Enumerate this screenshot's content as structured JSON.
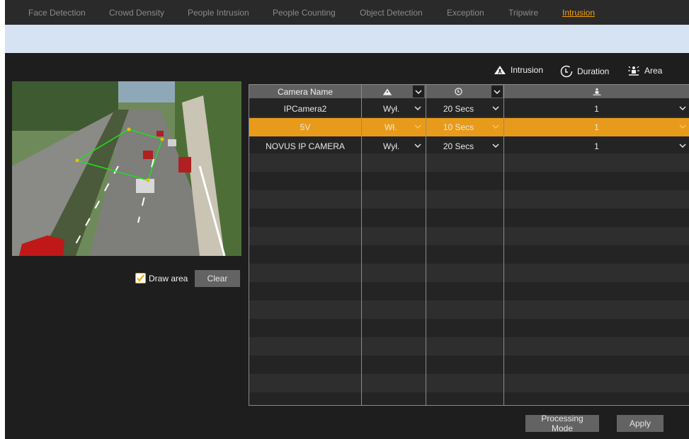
{
  "tabs": [
    {
      "label": "Face Detection",
      "active": false
    },
    {
      "label": "Crowd Density",
      "active": false
    },
    {
      "label": "People Intrusion",
      "active": false
    },
    {
      "label": "People Counting",
      "active": false
    },
    {
      "label": "Object Detection",
      "active": false
    },
    {
      "label": "Exception",
      "active": false
    },
    {
      "label": "Tripwire",
      "active": false
    },
    {
      "label": "Intrusion",
      "active": true
    }
  ],
  "legend": {
    "intrusion_label": "Intrusion",
    "duration_label": "Duration",
    "area_label": "Area"
  },
  "preview": {
    "draw_area_label": "Draw area",
    "draw_area_checked": true,
    "clear_label": "Clear"
  },
  "table": {
    "headers": {
      "camera_name": "Camera Name"
    },
    "rows": [
      {
        "camera": "IPCamera2",
        "intrusion": "Wył.",
        "duration": "20 Secs",
        "area": "1",
        "selected": false
      },
      {
        "camera": "5V",
        "intrusion": "Wł.",
        "duration": "10 Secs",
        "area": "1",
        "selected": true
      },
      {
        "camera": "NOVUS IP CAMERA",
        "intrusion": "Wył.",
        "duration": "20 Secs",
        "area": "1",
        "selected": false
      }
    ]
  },
  "footer": {
    "processing_mode_label": "Processing Mode",
    "apply_label": "Apply"
  },
  "colors": {
    "accent": "#f5a000",
    "selected_row": "#e89b1a",
    "header_bg": "#606060",
    "panel_bg": "#1e1e1e"
  }
}
